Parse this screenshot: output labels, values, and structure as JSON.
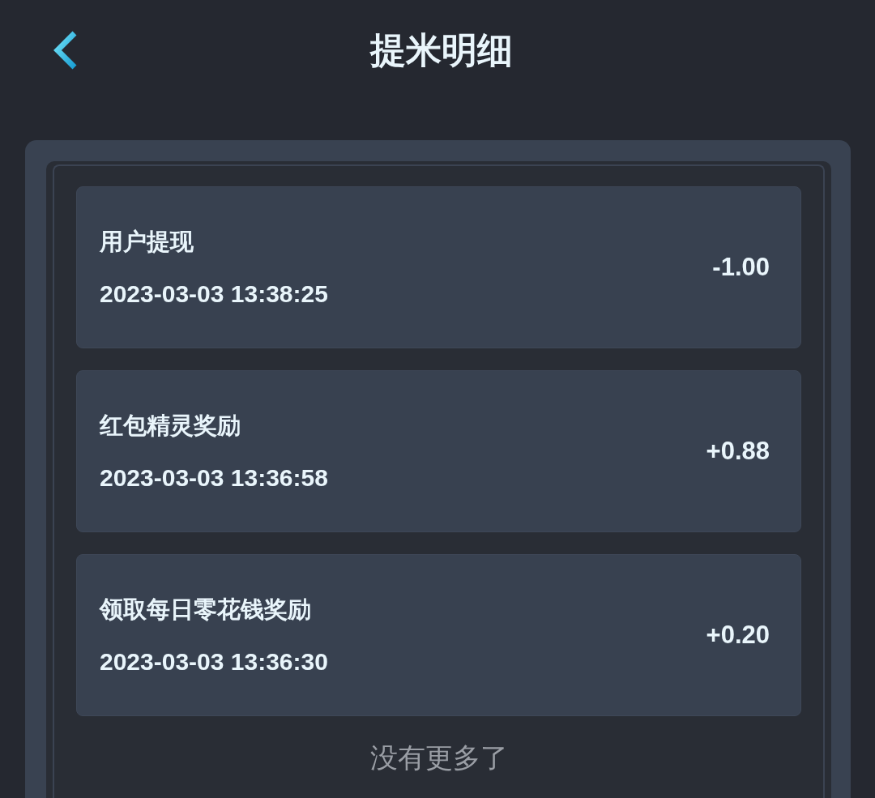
{
  "header": {
    "title": "提米明细"
  },
  "records": [
    {
      "title": "用户提现",
      "time": "2023-03-03 13:38:25",
      "amount": "-1.00"
    },
    {
      "title": "红包精灵奖励",
      "time": "2023-03-03 13:36:58",
      "amount": "+0.88"
    },
    {
      "title": "领取每日零花钱奖励",
      "time": "2023-03-03 13:36:30",
      "amount": "+0.20"
    }
  ],
  "footer_note": "没有更多了"
}
